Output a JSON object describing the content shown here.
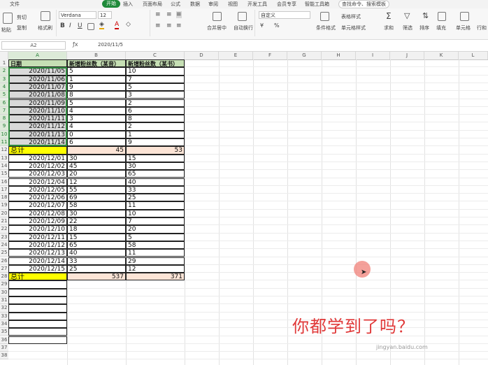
{
  "menu": [
    "文件",
    "开始",
    "插入",
    "页面布局",
    "公式",
    "数据",
    "审阅",
    "视图",
    "开发工具",
    "会员专享",
    "智能工具箱"
  ],
  "search_placeholder": "查找命令、搜索模板",
  "ribbon": {
    "paste": "粘贴",
    "cut": "剪切",
    "copy": "复制",
    "format_painter": "格式刷",
    "font_name": "Verdana",
    "font_size": "12",
    "merge": "合并居中",
    "wrap": "自动换行",
    "number_format": "自定义",
    "cond_format": "条件格式",
    "table_style": "表格样式",
    "cell_style": "单元格样式",
    "sum": "求和",
    "filter": "筛选",
    "sort": "排序",
    "fill": "填充",
    "cell": "单元格",
    "rowcol": "行和"
  },
  "name_box": "A2",
  "formula_value": "2020/11/5",
  "columns": [
    "A",
    "B",
    "C",
    "D",
    "E",
    "F",
    "G",
    "H",
    "I",
    "J",
    "K",
    "L"
  ],
  "header_row": [
    "日期",
    "新增粉丝数（某音）",
    "新增粉丝数（某书）"
  ],
  "group1": [
    [
      "2020/11/05",
      "5",
      "10"
    ],
    [
      "2020/11/06",
      "1",
      "7"
    ],
    [
      "2020/11/07",
      "9",
      "5"
    ],
    [
      "2020/11/08",
      "8",
      "3"
    ],
    [
      "2020/11/09",
      "5",
      "2"
    ],
    [
      "2020/11/10",
      "4",
      "6"
    ],
    [
      "2020/11/11",
      "3",
      "8"
    ],
    [
      "2020/11/12",
      "4",
      "2"
    ],
    [
      "2020/11/13",
      "0",
      "1"
    ],
    [
      "2020/11/14",
      "6",
      "9"
    ]
  ],
  "total1": [
    "总计",
    "45",
    "53"
  ],
  "group2": [
    [
      "2020/12/01",
      "30",
      "15"
    ],
    [
      "2020/12/02",
      "45",
      "30"
    ],
    [
      "2020/12/03",
      "20",
      "65"
    ],
    [
      "2020/12/04",
      "12",
      "40"
    ],
    [
      "2020/12/05",
      "55",
      "33"
    ],
    [
      "2020/12/06",
      "69",
      "25"
    ],
    [
      "2020/12/07",
      "58",
      "11"
    ],
    [
      "2020/12/08",
      "30",
      "10"
    ],
    [
      "2020/12/09",
      "22",
      "7"
    ],
    [
      "2020/12/10",
      "18",
      "20"
    ],
    [
      "2020/12/11",
      "15",
      "5"
    ],
    [
      "2020/12/12",
      "65",
      "58"
    ],
    [
      "2020/12/13",
      "40",
      "11"
    ],
    [
      "2020/12/14",
      "33",
      "29"
    ],
    [
      "2020/12/15",
      "25",
      "12"
    ]
  ],
  "total2": [
    "总计",
    "537",
    "371"
  ],
  "row_numbers": [
    "1",
    "2",
    "3",
    "4",
    "5",
    "6",
    "7",
    "8",
    "9",
    "10",
    "11",
    "12",
    "13",
    "14",
    "15",
    "16",
    "17",
    "18",
    "19",
    "20",
    "21",
    "22",
    "23",
    "24",
    "25",
    "26",
    "27",
    "28",
    "29",
    "30",
    "31",
    "32",
    "33",
    "34",
    "35",
    "36",
    "37",
    "38"
  ],
  "overlay_text": "你都学到了吗？",
  "watermark_url": "jingyan.baidu.com",
  "colors": {
    "header_fill": "#c6dfb4",
    "total_fill": "#ffff00",
    "total_value_fill": "#fce4d6",
    "selection_fill": "#d9d9d9",
    "accent": "#1f8a3a",
    "overlay": "#e03838"
  }
}
